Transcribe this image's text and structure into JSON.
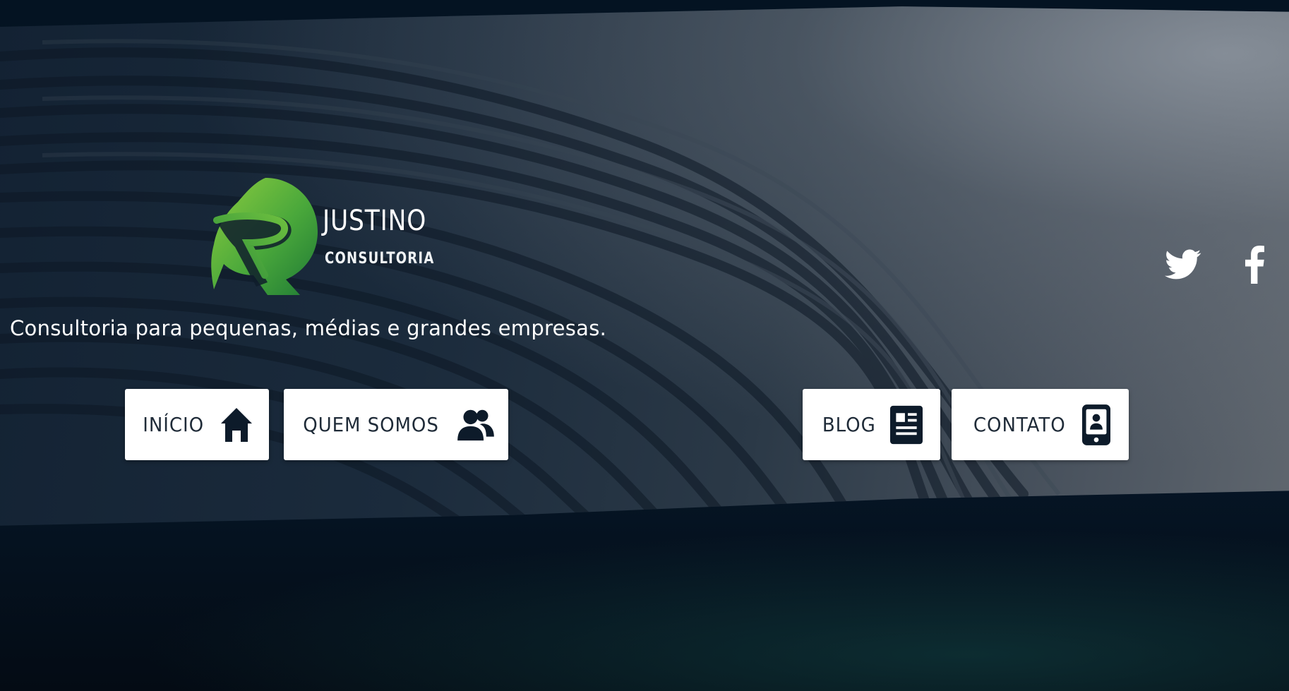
{
  "brand": {
    "name": "JUSTINO",
    "subtitle": "CONSULTORIA",
    "logo_icon": "r-swoosh-logo-icon",
    "colors": {
      "green_light": "#7cc242",
      "green_dark": "#2e8b3a"
    }
  },
  "tagline": "Consultoria para pequenas, médias e grandes empresas.",
  "social": [
    {
      "name": "twitter",
      "icon": "twitter-icon"
    },
    {
      "name": "facebook",
      "icon": "facebook-icon"
    }
  ],
  "nav": {
    "inicio": {
      "label": "INÍCIO",
      "icon": "home-icon"
    },
    "quem": {
      "label": "QUEM SOMOS",
      "icon": "users-icon"
    },
    "blog": {
      "label": "BLOG",
      "icon": "newspaper-icon"
    },
    "contato": {
      "label": "CONTATO",
      "icon": "mobile-contact-icon"
    }
  },
  "colors": {
    "background": "#071421",
    "button_bg": "#ffffff",
    "button_text": "#1f2b38",
    "icon_dark": "#0d1b2a"
  }
}
